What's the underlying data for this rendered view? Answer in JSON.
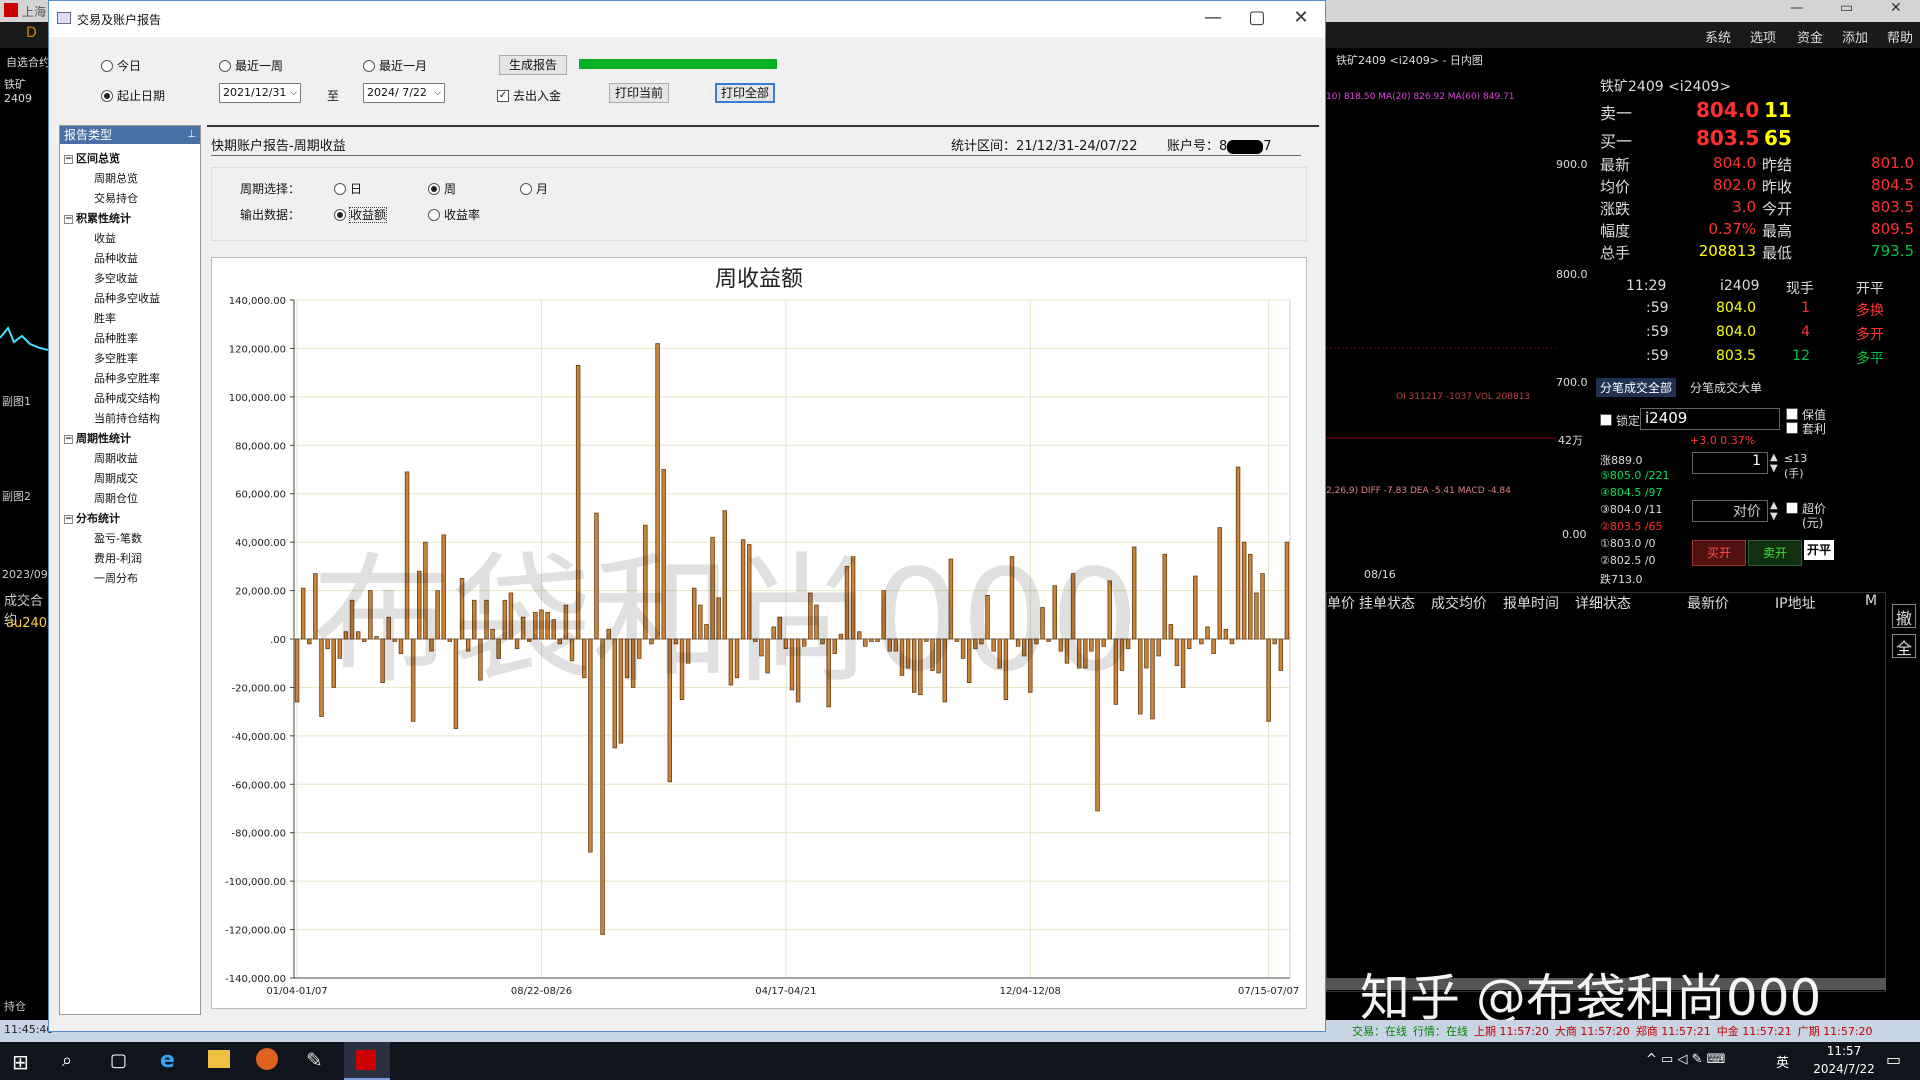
{
  "background_app": {
    "title_fragment": "上海",
    "menu": [
      "系统",
      "选项",
      "资金",
      "添加",
      "帮助"
    ],
    "left_labels": [
      "自选合约",
      "铁矿2409",
      "副图1",
      "副图2",
      "2023/09",
      "成交合约",
      "au240",
      "持仓"
    ],
    "chart_header": "铁矿2409 <i2409>  - 日内图",
    "indicator_line1": "10) 818.50  MA(20) 826.92  MA(60) 849.71",
    "price_ticks": [
      "900.0",
      "800.0",
      "700.0",
      "42万",
      "0.00"
    ],
    "oi_line": "OI 311217 -1037  VOL 208813",
    "macd_line": "2,26,9) DIFF -7.83 DEA -5.41 MACD -4.84",
    "date_tick": "08/16",
    "quote": {
      "title": "铁矿2409 <i2409>",
      "sell_label": "卖一",
      "sell_price": "804.0",
      "sell_vol": "11",
      "buy_label": "买一",
      "buy_price": "803.5",
      "buy_vol": "65",
      "rows": [
        [
          "最新",
          "804.0",
          "昨结",
          "801.0"
        ],
        [
          "均价",
          "802.0",
          "昨收",
          "804.5"
        ],
        [
          "涨跌",
          "3.0",
          "今开",
          "803.5"
        ],
        [
          "幅度",
          "0.37%",
          "最高",
          "809.5"
        ],
        [
          "总手",
          "208813",
          "最低",
          "793.5"
        ]
      ],
      "tick_header": [
        "11:29",
        "i2409",
        "现手",
        "开平"
      ],
      "ticks": [
        [
          ":59",
          "804.0",
          "1",
          "多换"
        ],
        [
          ":59",
          "804.0",
          "4",
          "多开"
        ],
        [
          ":59",
          "803.5",
          "12",
          "多平"
        ]
      ],
      "tabs": [
        "分笔成交全部",
        "分笔成交大单"
      ]
    },
    "order": {
      "lock_label": "锁定",
      "contract": "i2409",
      "change": "+3.0  0.37%",
      "hedge": "保值",
      "arb": "套利",
      "qty": "1",
      "qty_unit": "≤13 (手)",
      "price_mode": "对价",
      "over_price": "超价",
      "over_unit": "(元)",
      "levels": [
        "涨889.0",
        "⑤805.0 /221",
        "④804.5 /97",
        "③804.0 /11",
        "②803.5 /65",
        "①803.0 /0",
        "②802.5 /0",
        "跌713.0"
      ],
      "buy_open": "买开",
      "sell_open": "卖开",
      "close": "开平"
    },
    "order_table_headers": [
      "单价",
      "挂单状态",
      "成交均价",
      "报单时间",
      "详细状态",
      "最新价",
      "IP地址",
      "M"
    ],
    "side_buttons": [
      "撤",
      "全"
    ],
    "status_left": "11:45:40",
    "status_right": [
      "交易：在线",
      "行情：在线",
      "上期 11:57:20",
      "大商 11:57:20",
      "郑商 11:57:21",
      "中金 11:57:21",
      "广期 11:57:20"
    ],
    "taskbar_time": "11:57",
    "taskbar_date": "2024/7/22",
    "ime": "英",
    "watermark2": "知乎 @布袋和尚000"
  },
  "dialog": {
    "title": "交易及账户报告",
    "range_options": [
      {
        "label": "今日",
        "selected": false
      },
      {
        "label": "最近一周",
        "selected": false
      },
      {
        "label": "最近一月",
        "selected": false
      },
      {
        "label": "起止日期",
        "selected": true
      }
    ],
    "generate_btn": "生成报告",
    "progress": 1.0,
    "start_date": "2021/12/31",
    "to_label": "至",
    "end_date": "2024/ 7/22",
    "exclude_cash_label": "去出入金",
    "exclude_cash_checked": true,
    "print_current": "打印当前",
    "print_all": "打印全部",
    "tree_header": "报告类型",
    "tree": [
      {
        "label": "区间总览",
        "group": true,
        "items": [
          "周期总览",
          "交易持仓"
        ]
      },
      {
        "label": "积累性统计",
        "group": true,
        "items": [
          "收益",
          "品种收益",
          "多空收益",
          "品种多空收益",
          "胜率",
          "品种胜率",
          "多空胜率",
          "品种多空胜率",
          "品种成交结构",
          "当前持仓结构"
        ]
      },
      {
        "label": "周期性统计",
        "group": true,
        "items": [
          "周期收益",
          "周期成交",
          "周期仓位"
        ]
      },
      {
        "label": "分布统计",
        "group": true,
        "items": [
          "盈亏-笔数",
          "费用-利润",
          "一周分布"
        ]
      }
    ],
    "report_title": "快期账户报告-周期收益",
    "period_label": "统计区间：21/12/31-24/07/22",
    "account_label": "账户号：8",
    "account_tail": "7",
    "period_select_label": "周期选择：",
    "period_opts": [
      {
        "label": "日",
        "selected": false
      },
      {
        "label": "周",
        "selected": true
      },
      {
        "label": "月",
        "selected": false
      }
    ],
    "output_label": "输出数据：",
    "output_opts": [
      {
        "label": "收益额",
        "selected": true
      },
      {
        "label": "收益率",
        "selected": false
      }
    ],
    "watermark": "布袋和尚000"
  },
  "chart_data": {
    "type": "bar",
    "title": "周收益额",
    "xlabel": "",
    "ylabel": "",
    "ylim": [
      -140000,
      140000
    ],
    "ytick_labels": [
      "140,000.00",
      "120,000.00",
      "100,000.00",
      "80,000.00",
      "60,000.00",
      "40,000.00",
      "20,000.00",
      ".00",
      "-20,000.00",
      "-40,000.00",
      "-60,000.00",
      "-80,000.00",
      "-100,000.00",
      "-120,000.00",
      "-140,000.00"
    ],
    "xtick_labels": [
      "01/04-01/07",
      "08/22-08/26",
      "04/17-04/21",
      "12/04-12/08",
      "07/15-07/07"
    ],
    "xtick_index": [
      0,
      40,
      80,
      120,
      159
    ],
    "bar_color": "#c8843c",
    "values": [
      -26000,
      21000,
      -2000,
      27000,
      -32000,
      -4000,
      -20000,
      -8000,
      3000,
      16000,
      3000,
      -1000,
      20000,
      1000,
      -18000,
      9000,
      -1000,
      -6000,
      69000,
      -34000,
      28000,
      40000,
      -5000,
      20000,
      43000,
      -1000,
      -37000,
      25000,
      -5000,
      16000,
      -17000,
      16000,
      4000,
      -8000,
      16000,
      19000,
      -4000,
      9000,
      -1000,
      11000,
      12000,
      11000,
      8000,
      -2000,
      14000,
      -9000,
      113000,
      -16000,
      -88000,
      52000,
      -122000,
      4000,
      -45000,
      -43000,
      -16000,
      -20000,
      -8000,
      47000,
      -2000,
      122000,
      70000,
      -59000,
      -2000,
      -25000,
      -10000,
      21000,
      14000,
      6000,
      42000,
      17000,
      53000,
      -19000,
      -16000,
      41000,
      39000,
      -1000,
      -7000,
      -14000,
      5000,
      9000,
      -4000,
      -21000,
      -26000,
      -3000,
      19000,
      14000,
      -2000,
      -28000,
      -6000,
      2000,
      30000,
      34000,
      3000,
      -3000,
      -1000,
      -1000,
      20000,
      -5000,
      -5000,
      -15000,
      -12000,
      -22000,
      -23000,
      -1000,
      -13000,
      -14000,
      -26000,
      33000,
      -1000,
      -8000,
      -18000,
      -4000,
      -2000,
      18000,
      -5000,
      -12000,
      -25000,
      34000,
      -3000,
      -7000,
      -22000,
      -2000,
      13000,
      -1000,
      22000,
      -5000,
      -10000,
      27000,
      -12000,
      -12000,
      -5000,
      -71000,
      -3000,
      24000,
      -27000,
      -13000,
      -4000,
      38000,
      -31000,
      -12000,
      -33000,
      -7000,
      35000,
      6000,
      -11000,
      -20000,
      -4000,
      26000,
      -2000,
      5000,
      -6000,
      46000,
      4000,
      -2000,
      71000,
      40000,
      35000,
      19000,
      27000,
      -34000,
      -2000,
      -13000,
      40000
    ]
  }
}
